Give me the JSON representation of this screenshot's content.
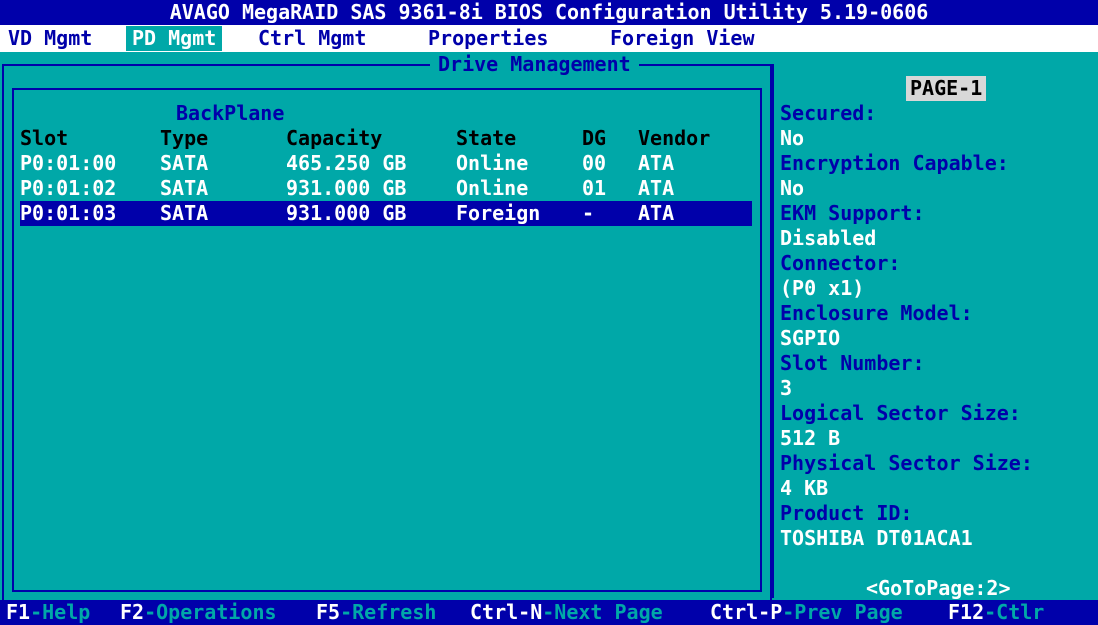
{
  "title": "AVAGO MegaRAID SAS 9361-8i BIOS Configuration Utility 5.19-0606",
  "menu": [
    {
      "label": "VD Mgmt"
    },
    {
      "label": "PD Mgmt"
    },
    {
      "label": "Ctrl Mgmt"
    },
    {
      "label": "Properties"
    },
    {
      "label": "Foreign View"
    }
  ],
  "drive_management": {
    "title": "Drive Management",
    "group_label": "BackPlane",
    "headers": {
      "slot": "Slot",
      "type": "Type",
      "capacity": "Capacity",
      "state": "State",
      "dg": "DG",
      "vendor": "Vendor"
    },
    "rows": [
      {
        "slot": "P0:01:00",
        "type": "SATA",
        "capacity": "465.250 GB",
        "state": "Online",
        "dg": "00",
        "vendor": "ATA"
      },
      {
        "slot": "P0:01:02",
        "type": "SATA",
        "capacity": "931.000 GB",
        "state": "Online",
        "dg": "01",
        "vendor": "ATA"
      },
      {
        "slot": "P0:01:03",
        "type": "SATA",
        "capacity": "931.000 GB",
        "state": "Foreign",
        "dg": "-",
        "vendor": "ATA"
      }
    ]
  },
  "properties_panel": {
    "page_label": "PAGE-1",
    "items": [
      {
        "label": "Secured:",
        "value": "No"
      },
      {
        "label": "Encryption Capable:",
        "value": "No"
      },
      {
        "label": "EKM Support:",
        "value": "Disabled"
      },
      {
        "label": "Connector:",
        "value": "(P0 x1)"
      },
      {
        "label": "Enclosure Model:",
        "value": "SGPIO"
      },
      {
        "label": "Slot Number:",
        "value": "3"
      },
      {
        "label": "Logical Sector Size:",
        "value": "512 B"
      },
      {
        "label": "Physical Sector Size:",
        "value": "4 KB"
      },
      {
        "label": "Product ID:",
        "value": "TOSHIBA DT01ACA1"
      }
    ],
    "goto_page": "<GoToPage:2>"
  },
  "status_bar": [
    {
      "key": "F1",
      "desc": "-Help"
    },
    {
      "key": "F2",
      "desc": "-Operations"
    },
    {
      "key": "F5",
      "desc": "-Refresh"
    },
    {
      "key": "Ctrl-N",
      "desc": "-Next Page"
    },
    {
      "key": "Ctrl-P",
      "desc": "-Prev Page"
    },
    {
      "key": "F12",
      "desc": "-Ctlr"
    }
  ],
  "colors": {
    "background": "#00a8a8",
    "blue": "#0000aa",
    "white": "#ffffff",
    "page_label_bg": "#d8d8d8"
  }
}
